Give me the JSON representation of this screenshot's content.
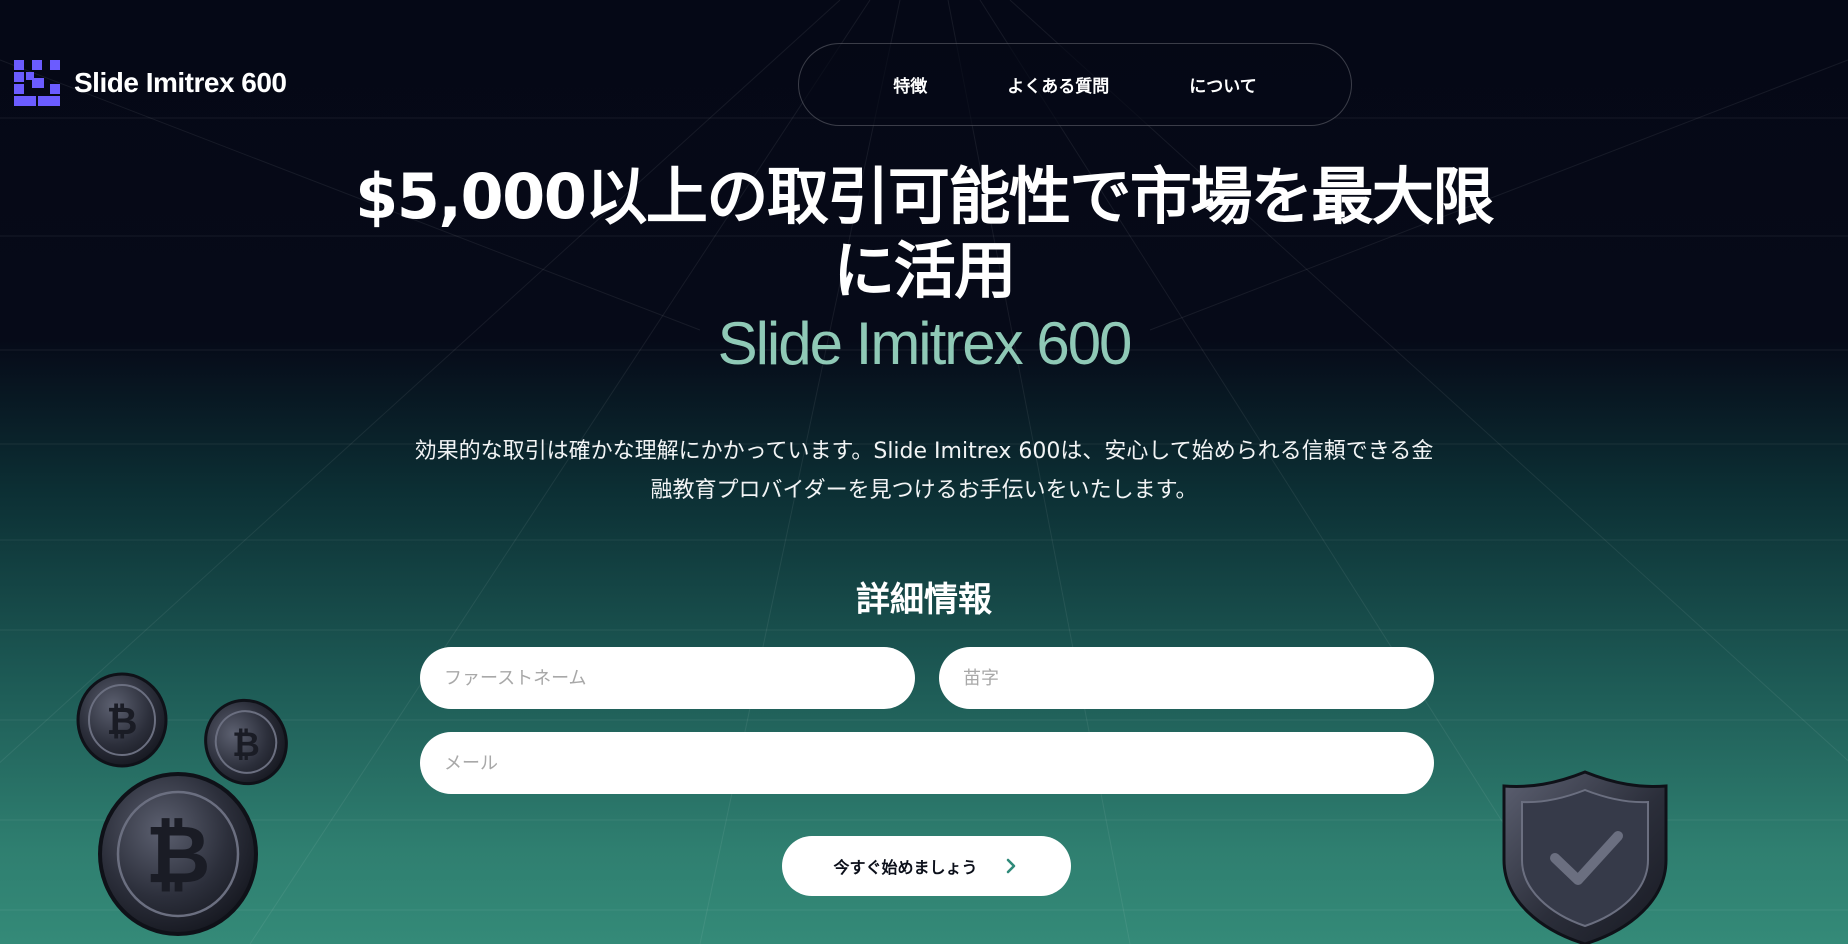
{
  "brand": {
    "name": "Slide Imitrex 600"
  },
  "nav": {
    "items": [
      {
        "label": "特徴"
      },
      {
        "label": "よくある質問"
      },
      {
        "label": "について"
      }
    ]
  },
  "hero": {
    "title_line1": "$5,000以上の取引可能性で市場を最大限",
    "title_line2": "に活用",
    "brand_line": "Slide Imitrex 600",
    "description_line1": "効果的な取引は確かな理解にかかっています。Slide Imitrex 600は、安心して始められる信頼できる金",
    "description_line2": "融教育プロバイダーを見つけるお手伝いをいたします。"
  },
  "form": {
    "title": "詳細情報",
    "first_name_placeholder": "ファーストネーム",
    "last_name_placeholder": "苗字",
    "email_placeholder": "メール",
    "submit_label": "今すぐ始めましょう"
  },
  "colors": {
    "background_top": "#050816",
    "background_bottom": "#348a78",
    "brand_accent": "#6b5cff",
    "brand_line_text": "#8fc9b6",
    "chevron": "#2f8a7a"
  },
  "icons": [
    "logo-mark-icon",
    "chevron-right-icon",
    "bitcoin-coin-icon",
    "shield-check-icon"
  ]
}
